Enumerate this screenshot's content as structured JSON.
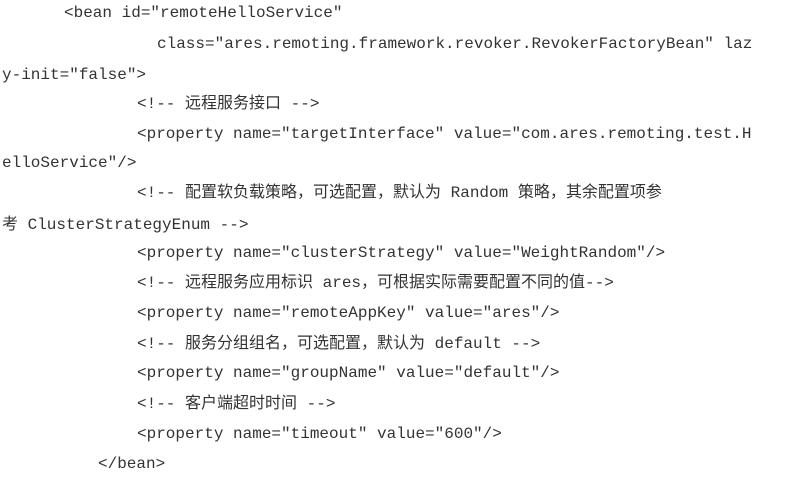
{
  "document": {
    "lines": [
      "<bean id=\"remoteHelloService\"",
      "class=\"ares.remoting.framework.revoker.RevokerFactoryBean\" laz",
      "y-init=\"false\">",
      "<!-- 远程服务接口 -->",
      "<property name=\"targetInterface\" value=\"com.ares.remoting.test.H",
      "elloService\"/>",
      "<!-- 配置软负载策略，可选配置，默认为 Random 策略，其余配置项参",
      "考 ClusterStrategyEnum -->",
      "<property name=\"clusterStrategy\" value=\"WeightRandom\"/>",
      "<!-- 远程服务应用标识 ares，可根据实际需要配置不同的值-->",
      "<property name=\"remoteAppKey\" value=\"ares\"/>",
      "<!-- 服务分组组名，可选配置，默认为 default -->",
      "<property name=\"groupName\" value=\"default\"/>",
      "<!-- 客户端超时时间 -->",
      "<property name=\"timeout\" value=\"600\"/>",
      "</bean>"
    ]
  }
}
